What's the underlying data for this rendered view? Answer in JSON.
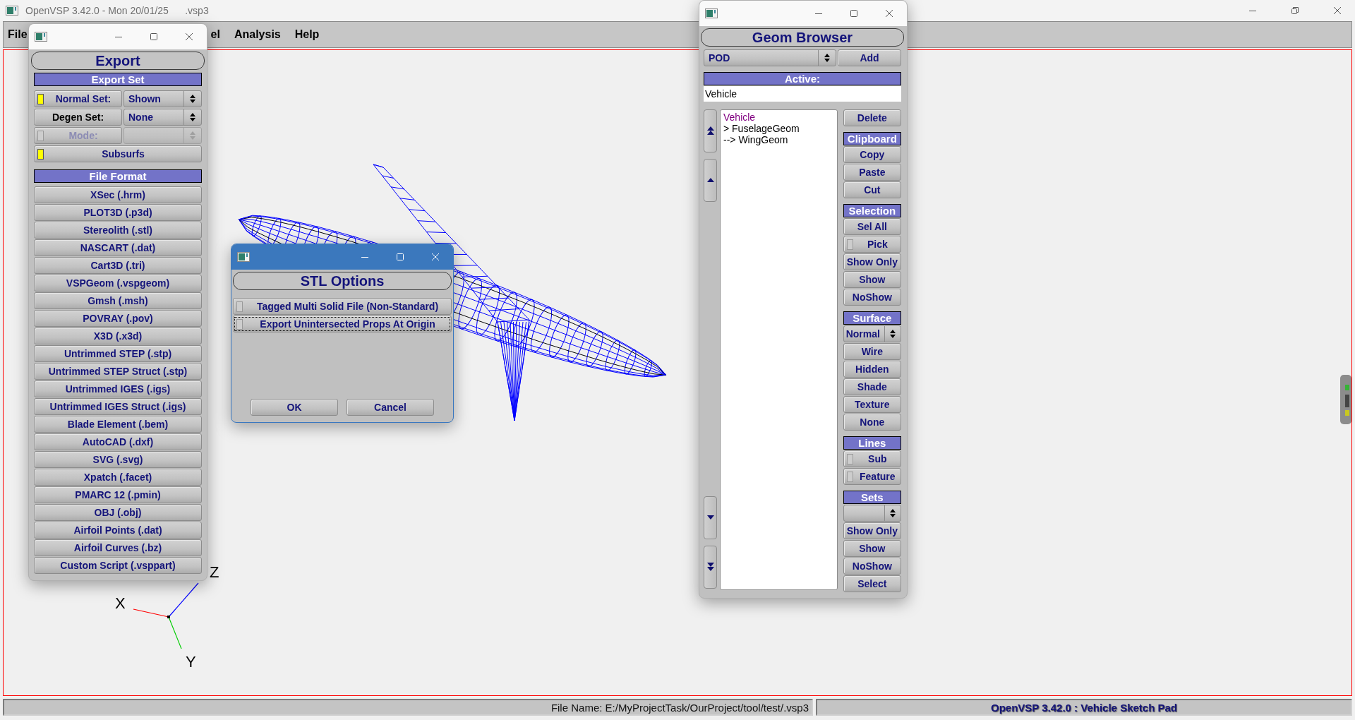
{
  "window": {
    "title": "OpenVSP 3.42.0 - Mon 20/01/25      .vsp3"
  },
  "menu": [
    {
      "label": "File"
    },
    {
      "label": "el"
    },
    {
      "label": "Analysis"
    },
    {
      "label": "Help"
    }
  ],
  "viewport": {
    "axis_labels": [
      "X",
      "Z",
      "Y"
    ]
  },
  "export_window": {
    "title": "Export",
    "export_set": {
      "header": "Export Set",
      "rows": [
        {
          "kind": "toggle_choice",
          "label": "Normal Set:",
          "checked": true,
          "disabled": false,
          "value": "Shown"
        },
        {
          "kind": "label_choice",
          "label": "Degen Set:",
          "value": "None"
        },
        {
          "kind": "toggle_choice",
          "label": "Mode:",
          "checked": false,
          "disabled": true
        },
        {
          "kind": "toggle",
          "label": "Subsurfs",
          "checked": true
        }
      ]
    },
    "file_format": {
      "header": "File Format",
      "buttons": [
        "XSec (.hrm)",
        "PLOT3D (.p3d)",
        "Stereolith (.stl)",
        "NASCART (.dat)",
        "Cart3D (.tri)",
        "VSPGeom (.vspgeom)",
        "Gmsh (.msh)",
        "POVRAY (.pov)",
        "X3D (.x3d)",
        "Untrimmed STEP (.stp)",
        "Untrimmed STEP Struct (.stp)",
        "Untrimmed IGES (.igs)",
        "Untrimmed IGES Struct (.igs)",
        "Blade Element (.bem)",
        "AutoCAD (.dxf)",
        "SVG (.svg)",
        "Xpatch (.facet)",
        "PMARC 12 (.pmin)",
        "OBJ (.obj)",
        "Airfoil Points (.dat)",
        "Airfoil Curves (.bz)",
        "Custom Script (.vsppart)"
      ]
    }
  },
  "stl_options": {
    "title": "STL Options",
    "options": [
      {
        "label": "Tagged Multi Solid File (Non-Standard)",
        "checked": false,
        "focused": false
      },
      {
        "label": "Export Unintersected Props At Origin",
        "checked": false,
        "focused": true
      }
    ],
    "buttons": [
      "OK",
      "Cancel"
    ]
  },
  "geom_browser": {
    "title": "Geom Browser",
    "geom_type": "POD",
    "add_button": "Add",
    "active_header": "Active:",
    "active_value": "Vehicle",
    "tree": [
      {
        "label": "Vehicle",
        "color": "#800080",
        "children": [
          {
            "label": "> FuselageGeom",
            "color": "#000000",
            "children": [
              {
                "label": "--> WingGeom",
                "color": "#000000"
              }
            ]
          }
        ]
      }
    ],
    "controls": [
      {
        "kind": "button",
        "label": "Delete"
      },
      {
        "kind": "header",
        "label": "Clipboard"
      },
      {
        "kind": "button",
        "label": "Copy"
      },
      {
        "kind": "button",
        "label": "Paste"
      },
      {
        "kind": "button",
        "label": "Cut"
      },
      {
        "kind": "header",
        "label": "Selection"
      },
      {
        "kind": "button",
        "label": "Sel All"
      },
      {
        "kind": "toggle",
        "label": "Pick",
        "checked": false
      },
      {
        "kind": "button",
        "label": "Show Only"
      },
      {
        "kind": "button",
        "label": "Show"
      },
      {
        "kind": "button",
        "label": "NoShow"
      },
      {
        "kind": "header",
        "label": "Surface"
      },
      {
        "kind": "choice",
        "value": "Normal"
      },
      {
        "kind": "button",
        "label": "Wire"
      },
      {
        "kind": "button",
        "label": "Hidden"
      },
      {
        "kind": "button",
        "label": "Shade"
      },
      {
        "kind": "button",
        "label": "Texture"
      },
      {
        "kind": "button",
        "label": "None"
      },
      {
        "kind": "header",
        "label": "Lines"
      },
      {
        "kind": "toggle",
        "label": "Sub",
        "checked": false
      },
      {
        "kind": "toggle",
        "label": "Feature",
        "checked": false
      },
      {
        "kind": "header",
        "label": "Sets"
      },
      {
        "kind": "choice"
      },
      {
        "kind": "button",
        "label": "Show Only"
      },
      {
        "kind": "button",
        "label": "Show"
      },
      {
        "kind": "button",
        "label": "NoShow"
      },
      {
        "kind": "button",
        "label": "Select"
      }
    ]
  },
  "status_bar": {
    "file_name": "File Name: E:/MyProjectTask/OurProject/tool/test/.vsp3",
    "app_name": "OpenVSP 3.42.0 : Vehicle Sketch Pad"
  }
}
